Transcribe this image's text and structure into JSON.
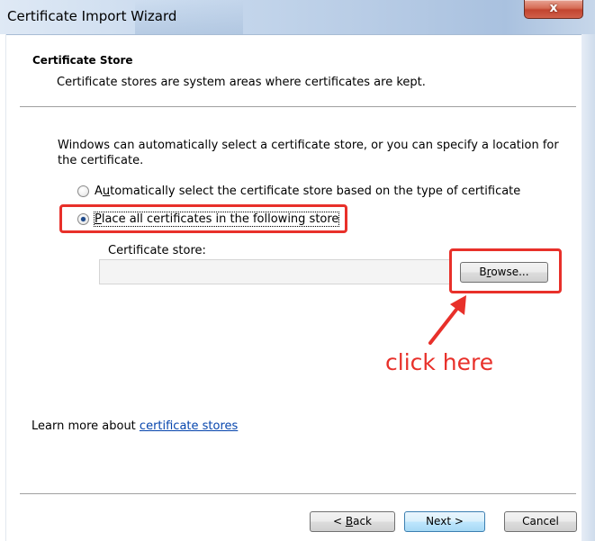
{
  "window": {
    "title": "Certificate Import Wizard",
    "close_glyph": "x"
  },
  "header": {
    "section_title": "Certificate Store",
    "section_desc": "Certificate stores are system areas where certificates are kept."
  },
  "body": {
    "intro": "Windows can automatically select a certificate store, or you can specify a location for the certificate.",
    "option_auto": {
      "mnemonic": "u",
      "label_prefix": "A",
      "label_rest": "tomatically select the certificate store based on the type of certificate",
      "checked": false
    },
    "option_place": {
      "mnemonic": "P",
      "label_rest": "lace all certificates in the following store",
      "checked": true
    },
    "store_label": "Certificate store:",
    "store_value": "",
    "browse_mnemonic": "r",
    "browse_prefix": "B",
    "browse_rest": "owse...",
    "annotation": "click here"
  },
  "footer": {
    "learn_prefix": "Learn more about ",
    "learn_link": "certificate stores",
    "back_prefix": "< ",
    "back_mnemonic": "B",
    "back_rest": "ack",
    "next": "Next >",
    "cancel": "Cancel"
  },
  "colors": {
    "annotation": "#e8302a",
    "link": "#0645ad"
  },
  "icons": {
    "close": "close-icon",
    "annotation_arrow": "arrow-icon"
  }
}
